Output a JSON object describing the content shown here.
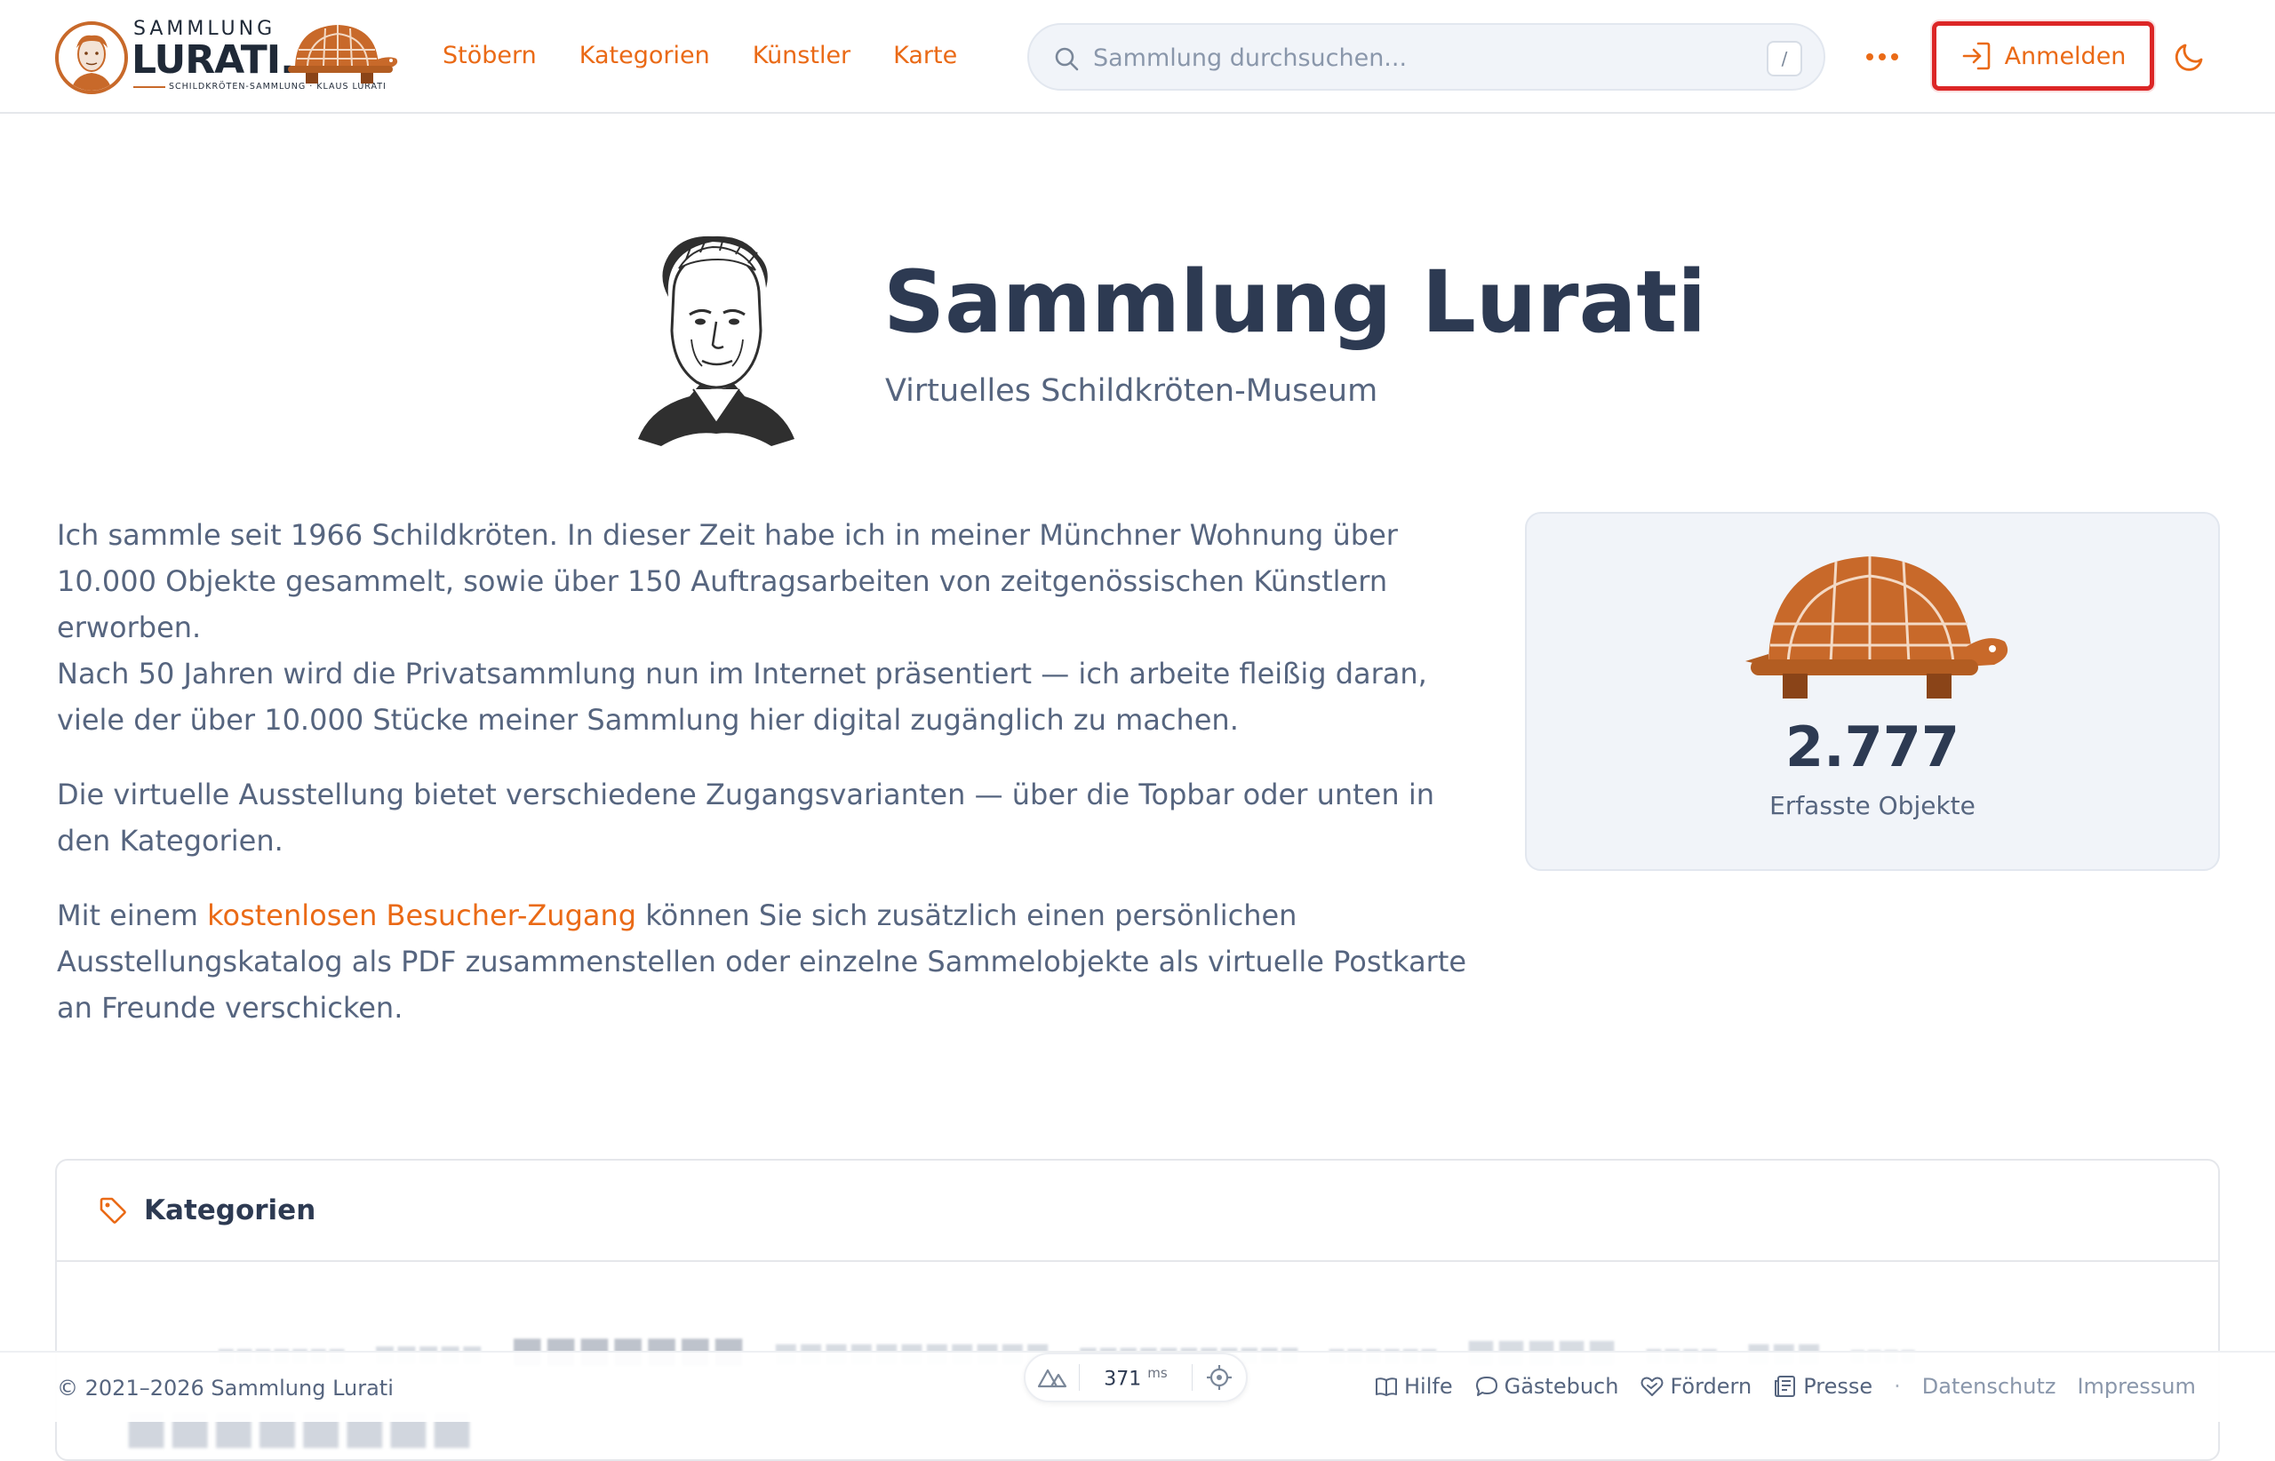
{
  "brand": {
    "logo_word1": "SAMMLUNG",
    "logo_word2": "LURATI.",
    "logo_tagline": "SCHILDKRÖTEN-SAMMLUNG · KLAUS LURATI",
    "accent": "#ea6a16",
    "turtle_color": "#c8692a"
  },
  "nav": {
    "items": [
      "Stöbern",
      "Kategorien",
      "Künstler",
      "Karte"
    ]
  },
  "search": {
    "placeholder": "Sammlung durchsuchen...",
    "shortcut": "/"
  },
  "header": {
    "more_icon": "more-dots-icon",
    "login_label": "Anmelden",
    "login_icon": "login-icon",
    "theme_icon": "moon-icon"
  },
  "hero": {
    "title": "Sammlung Lurati",
    "subtitle": "Virtuelles Schildkröten-Museum"
  },
  "intro": {
    "p1_line1": "Ich sammle seit 1966 Schildkröten. In dieser Zeit habe ich in meiner Münchner Wohnung über 10.000 Objekte gesammelt, sowie über 150 Auftragsarbeiten von zeitgenössischen Künstlern erworben.",
    "p1_line2": "Nach 50 Jahren wird die Privatsammlung nun im Internet präsentiert — ich arbeite fleißig daran, viele der über 10.000 Stücke meiner Sammlung hier digital zugänglich zu machen.",
    "p2": "Die virtuelle Ausstellung bietet verschiedene Zugangsvarianten — über die Topbar oder unten in den Kategorien.",
    "p3_before": "Mit einem ",
    "p3_link": "kostenlosen Besucher-Zugang",
    "p3_after": " können Sie sich zusätzlich einen persönlichen Ausstellungskatalog als PDF zusammenstellen oder einzelne Sammelobjekte als virtuelle Postkarte an Freunde verschicken."
  },
  "stats": {
    "count": "2.777",
    "label": "Erfasste Objekte"
  },
  "categories": {
    "title": "Kategorien",
    "icon": "tag-icon"
  },
  "footer": {
    "copyright": "© 2021–2026 Sammlung Lurati",
    "perf_ms": "371",
    "perf_unit": "ms",
    "links": [
      {
        "label": "Hilfe",
        "icon": "book-icon"
      },
      {
        "label": "Gästebuch",
        "icon": "chat-icon"
      },
      {
        "label": "Fördern",
        "icon": "heart-hand-icon"
      },
      {
        "label": "Presse",
        "icon": "newspaper-icon"
      }
    ],
    "separator": "·",
    "legal": [
      "Datenschutz",
      "Impressum"
    ]
  }
}
